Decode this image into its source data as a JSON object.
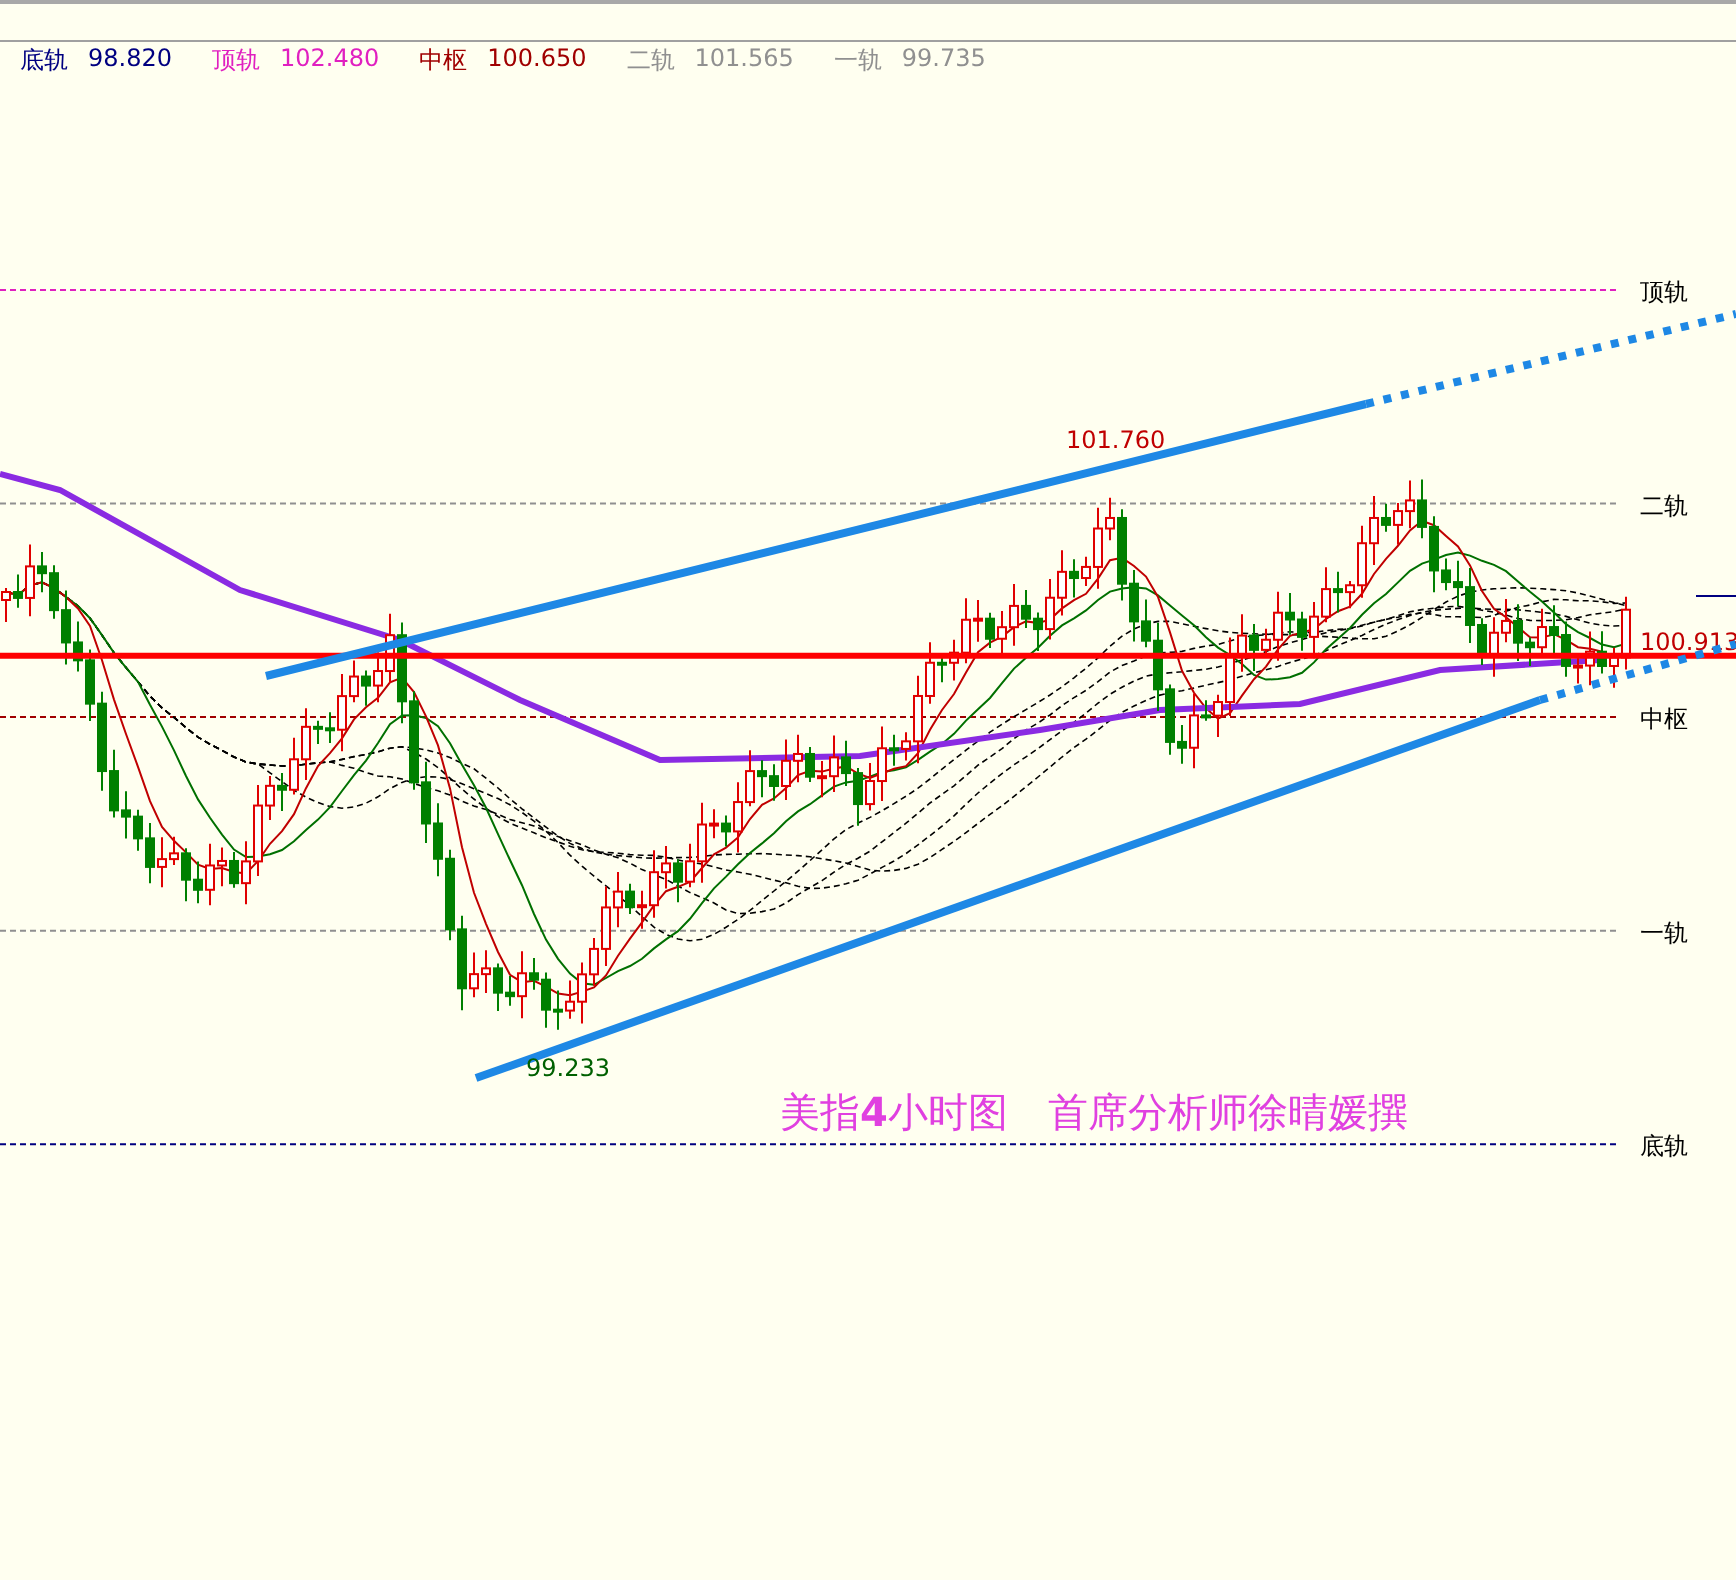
{
  "levels": [
    {
      "legend_label": "底轨",
      "value": "98.820",
      "color": "#000080"
    },
    {
      "legend_label": "顶轨",
      "value": "102.480",
      "color": "#e020c0"
    },
    {
      "legend_label": "中枢",
      "value": "100.650",
      "color": "#a00000"
    },
    {
      "legend_label": "二轨",
      "value": "101.565",
      "color": "#909090"
    },
    {
      "legend_label": "一轨",
      "value": "99.735",
      "color": "#909090"
    }
  ],
  "axis_labels": [
    "顶轨",
    "二轨",
    "中枢",
    "一轨",
    "底轨"
  ],
  "current_price": "100.913",
  "high_label": "101.760",
  "low_label": "99.233",
  "caption": "美指**4**小时图　首席分析师徐晴媛撰"
}
